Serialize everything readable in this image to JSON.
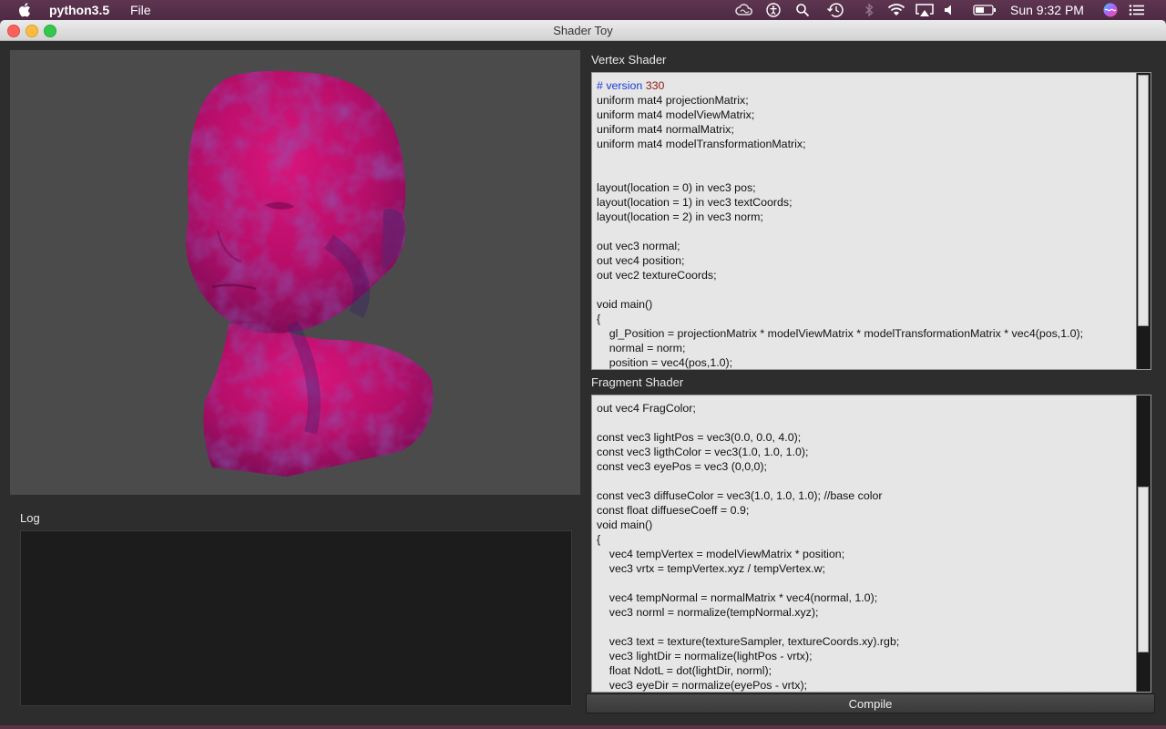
{
  "menubar": {
    "app_name": "python3.5",
    "file_menu": "File",
    "clock": "Sun 9:32 PM",
    "status_icons": [
      "creative-cloud-icon",
      "accessibility-icon",
      "search-icon",
      "time-machine-icon",
      "bluetooth-icon",
      "wifi-icon",
      "airplay-icon",
      "volume-icon",
      "battery-icon",
      "siri-icon",
      "notification-center-icon"
    ]
  },
  "window": {
    "title": "Shader Toy"
  },
  "viewport": {
    "background": "#4b4b4b",
    "model_color": "#c0106a"
  },
  "log": {
    "label": "Log",
    "content": ""
  },
  "vertex_shader": {
    "label": "Vertex Shader",
    "first_line_keyword": "# version",
    "first_line_number": "330",
    "code": "uniform mat4 projectionMatrix;\nuniform mat4 modelViewMatrix;\nuniform mat4 normalMatrix;\nuniform mat4 modelTransformationMatrix;\n\n\nlayout(location = 0) in vec3 pos;\nlayout(location = 1) in vec3 textCoords;\nlayout(location = 2) in vec3 norm;\n\nout vec3 normal;\nout vec4 position;\nout vec2 textureCoords;\n\nvoid main()\n{\n    gl_Position = projectionMatrix * modelViewMatrix * modelTransformationMatrix * vec4(pos,1.0);\n    normal = norm;\n    position = vec4(pos,1.0);"
  },
  "fragment_shader": {
    "label": "Fragment Shader",
    "code": "out vec4 FragColor;\n\nconst vec3 lightPos = vec3(0.0, 0.0, 4.0);\nconst vec3 ligthColor = vec3(1.0, 1.0, 1.0);\nconst vec3 eyePos = vec3 (0,0,0);\n\nconst vec3 diffuseColor = vec3(1.0, 1.0, 1.0); //base color\nconst float diffueseCoeff = 0.9;\nvoid main()\n{\n    vec4 tempVertex = modelViewMatrix * position;\n    vec3 vrtx = tempVertex.xyz / tempVertex.w;\n\n    vec4 tempNormal = normalMatrix * vec4(normal, 1.0);\n    vec3 norml = normalize(tempNormal.xyz);\n\n    vec3 text = texture(textureSampler, textureCoords.xy).rgb;\n    vec3 lightDir = normalize(lightPos - vrtx);\n    float NdotL = dot(lightDir, norml);\n    vec3 eyeDir = normalize(eyePos - vrtx);"
  },
  "compile_button": {
    "label": "Compile"
  }
}
